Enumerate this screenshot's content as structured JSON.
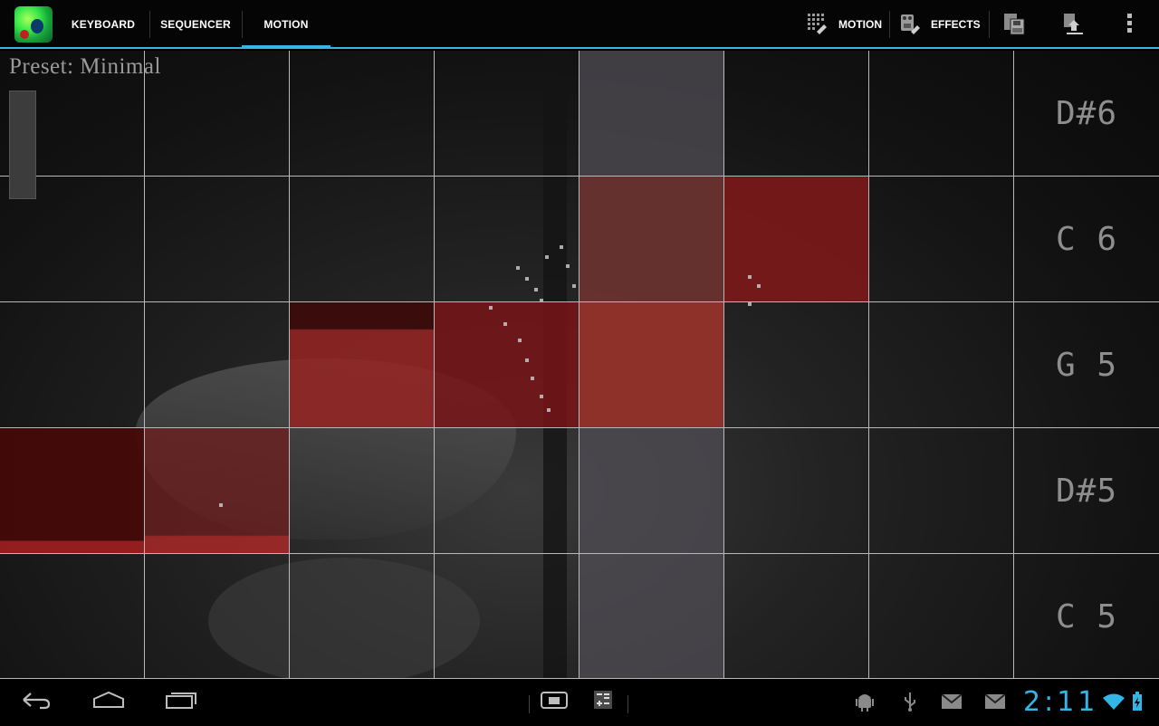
{
  "actionbar": {
    "tabs": [
      {
        "label": "KEYBOARD",
        "active": false
      },
      {
        "label": "SEQUENCER",
        "active": false
      },
      {
        "label": "MOTION",
        "active": true
      }
    ],
    "actions": {
      "motion_label": "MOTION",
      "effects_label": "EFFECTS"
    },
    "accent_color": "#33b5e5"
  },
  "main": {
    "preset_label": "Preset: Minimal",
    "notes": [
      "D#6",
      "C 6",
      "G 5",
      "D#5",
      "C 5"
    ],
    "grid": {
      "columns": 7,
      "rows": 5,
      "highlight_column": 5
    },
    "active_cells": [
      {
        "row": 2,
        "col": 5,
        "color": "#5a2a26"
      },
      {
        "row": 2,
        "col": 6,
        "color": "#7a1a1a"
      },
      {
        "row": 3,
        "col": 3,
        "color": "#8a2222"
      },
      {
        "row": 3,
        "col": 4,
        "color": "#6f1313"
      },
      {
        "row": 3,
        "col": 5,
        "color": "#8f2c24"
      },
      {
        "row": 4,
        "col": 1,
        "color": "#4a0808"
      },
      {
        "row": 4,
        "col": 2,
        "color": "#7a1f1f"
      }
    ]
  },
  "navbar": {
    "clock": "2:11"
  }
}
